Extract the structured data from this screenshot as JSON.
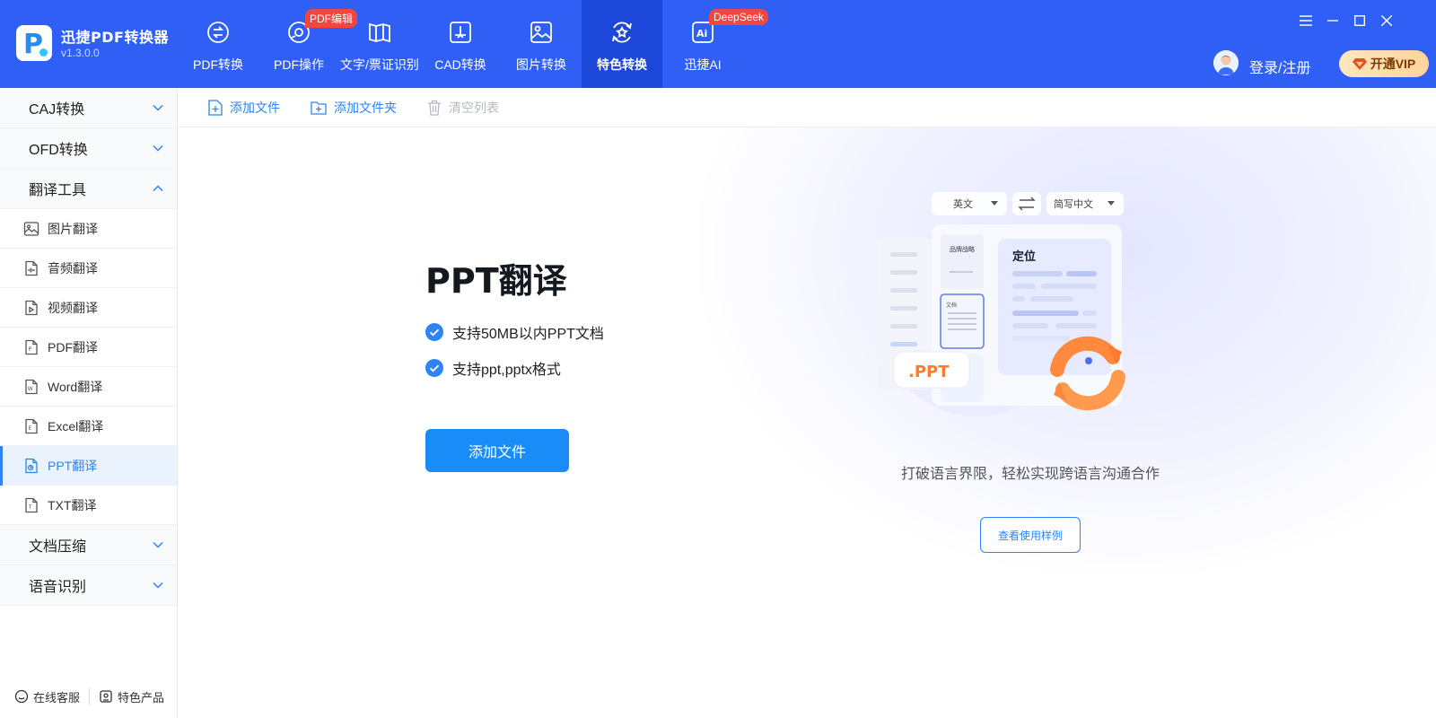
{
  "app": {
    "name": "迅捷PDF转换器",
    "version": "v1.3.0.0"
  },
  "nav": [
    {
      "label": "PDF转换"
    },
    {
      "label": "PDF操作",
      "badge": "PDF编辑"
    },
    {
      "label": "文字/票证识别"
    },
    {
      "label": "CAD转换"
    },
    {
      "label": "图片转换"
    },
    {
      "label": "特色转换",
      "active": true
    },
    {
      "label": "迅捷AI",
      "badge": "DeepSeek"
    }
  ],
  "header": {
    "login": "登录/注册",
    "vip": "开通VIP"
  },
  "sidebar": {
    "groups": [
      {
        "label": "CAJ转换"
      },
      {
        "label": "OFD转换"
      },
      {
        "label": "翻译工具"
      },
      {
        "label": "文档压缩"
      },
      {
        "label": "语音识别"
      }
    ],
    "items": [
      {
        "label": "图片翻译"
      },
      {
        "label": "音频翻译"
      },
      {
        "label": "视频翻译"
      },
      {
        "label": "PDF翻译"
      },
      {
        "label": "Word翻译"
      },
      {
        "label": "Excel翻译"
      },
      {
        "label": "PPT翻译",
        "active": true
      },
      {
        "label": "TXT翻译"
      }
    ],
    "footer": {
      "service": "在线客服",
      "products": "特色产品"
    }
  },
  "toolbar": {
    "add_file": "添加文件",
    "add_folder": "添加文件夹",
    "clear_list": "清空列表"
  },
  "main": {
    "title": "PPT翻译",
    "features": [
      "支持50MB以内PPT文档",
      "支持ppt,pptx格式"
    ],
    "add_button": "添加文件",
    "tagline": "打破语言界限，轻松实现跨语言沟通合作",
    "example_button": "查看使用样例"
  },
  "illustration": {
    "source_lang": "英文",
    "target_lang": "简写中文",
    "card_title": "定位",
    "thumb_title": "品牌战略",
    "thumb_label": "文档",
    "ppt_tag": ".PPT"
  },
  "colors": {
    "topbar": "#2f5ff5",
    "active_nav": "#1d47d9",
    "accent": "#2d84f2",
    "primary_button": "#1a8cf8",
    "badge": "#f5453f",
    "ppt_orange": "#ff7a2e"
  }
}
